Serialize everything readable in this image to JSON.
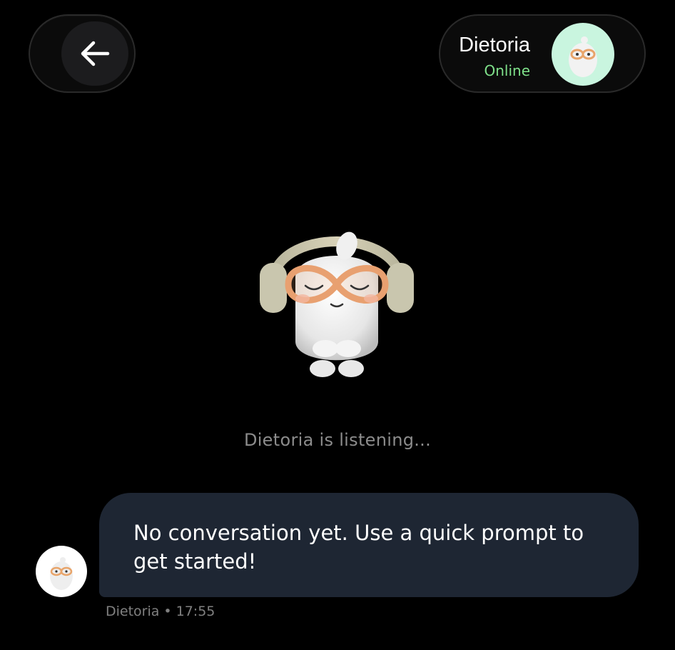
{
  "header": {
    "back_icon": "arrow-left-icon",
    "contact_name": "Dietoria",
    "contact_status": "Online",
    "status_color": "#7fe08a",
    "avatar_bg": "#c9f5df"
  },
  "main": {
    "status_text": "Dietoria is listening..."
  },
  "conversation": {
    "messages": [
      {
        "text": "No conversation yet. Use a quick prompt to get started!",
        "sender": "Dietoria",
        "separator": "•",
        "time": "17:55"
      }
    ]
  },
  "colors": {
    "background": "#000000",
    "bubble": "#1e2633"
  }
}
